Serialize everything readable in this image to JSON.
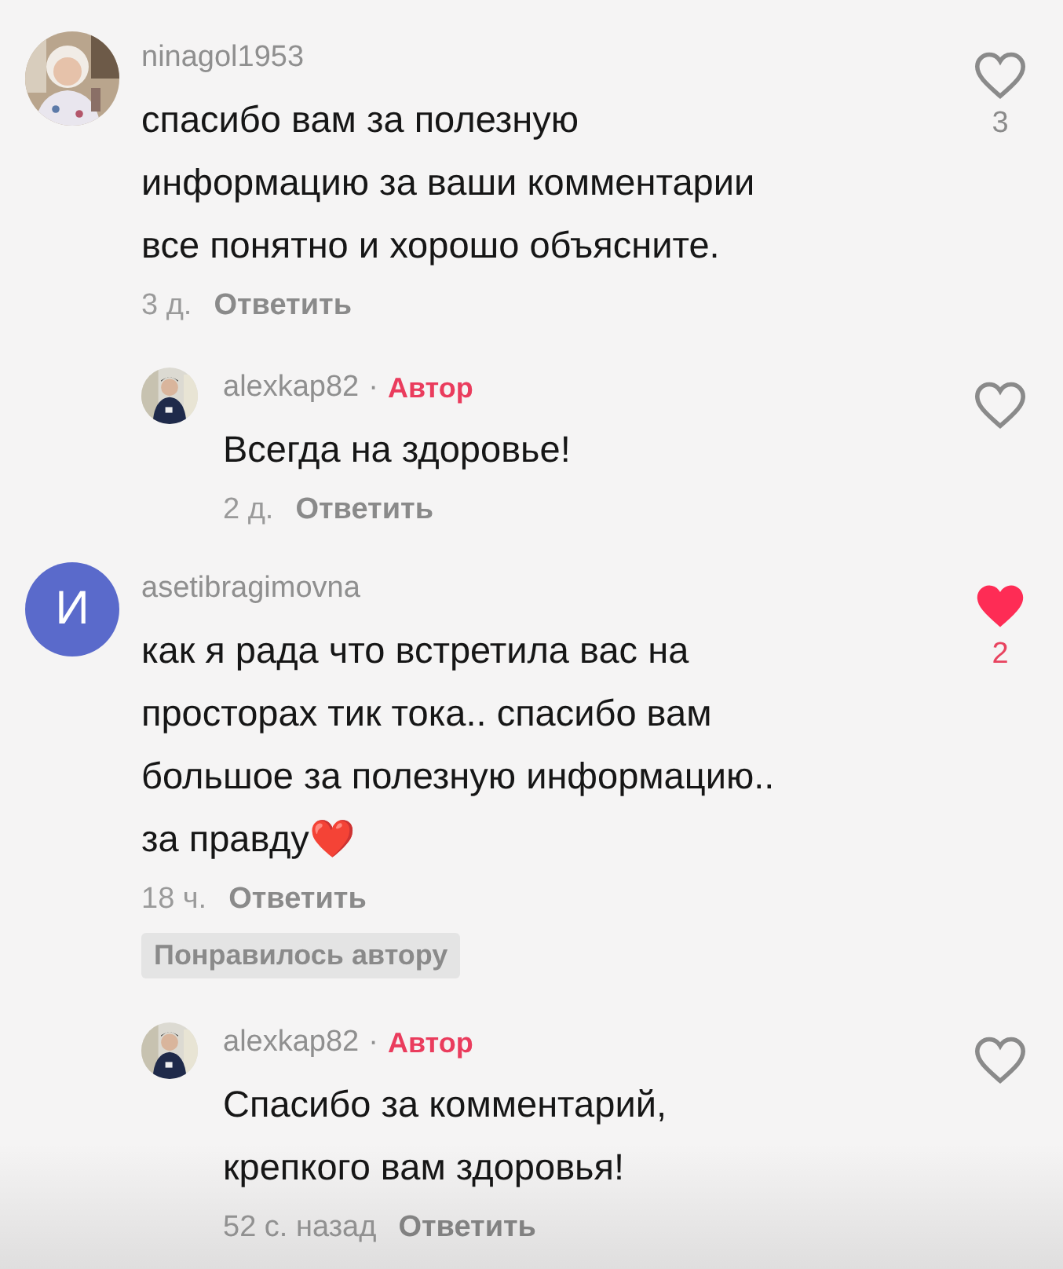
{
  "comments": [
    {
      "avatar": {
        "kind": "picture"
      },
      "username": "ninagol1953",
      "text": "спасибо вам за полезную\nинформацию за ваши комментарии\nвсе понятно и хорошо объясните.",
      "time": "3 д.",
      "reply": "Ответить",
      "liked": false,
      "likes": "3",
      "replies": [
        {
          "avatar": {
            "kind": "picture"
          },
          "username": "alexkap82",
          "separator": "·",
          "author_label": "Автор",
          "text": "Всегда на здоровье!",
          "time": "2 д.",
          "reply": "Ответить",
          "liked": false
        }
      ]
    },
    {
      "avatar": {
        "kind": "letter",
        "letter": "И",
        "color": "#5a6acb"
      },
      "username": "asetibragimovna",
      "text": "как я рада что встретила вас на\nпросторах тик тока.. спасибо вам\nбольшое за полезную информацию..\nза правду❤️",
      "time": "18 ч.",
      "reply": "Ответить",
      "liked": true,
      "likes": "2",
      "badge": "Понравилось автору",
      "replies": [
        {
          "avatar": {
            "kind": "picture"
          },
          "username": "alexkap82",
          "separator": "·",
          "author_label": "Автор",
          "text": "Спасибо за комментарий,\nкрепкого вам здоровья!",
          "time": "52 с. назад",
          "reply": "Ответить",
          "liked": false
        }
      ]
    }
  ]
}
